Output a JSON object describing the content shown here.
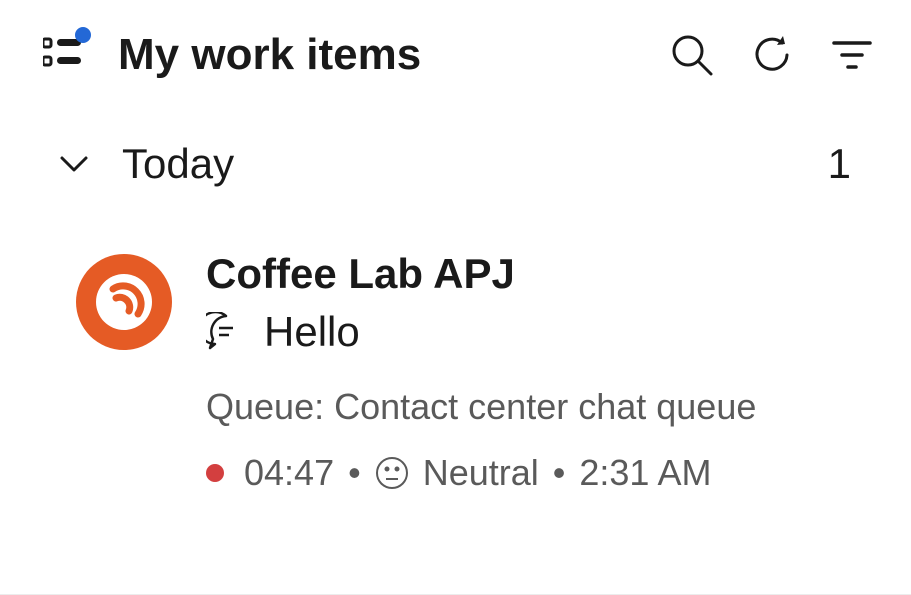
{
  "header": {
    "title": "My work items"
  },
  "section": {
    "label": "Today",
    "count": "1"
  },
  "item": {
    "title": "Coffee Lab APJ",
    "preview": "Hello",
    "queue_prefix": "Queue: ",
    "queue_name": "Contact center chat queue",
    "duration": "04:47",
    "sentiment": "Neutral",
    "time": "2:31 AM"
  },
  "icons": {
    "notification_color": "#2368d6",
    "avatar_bg": "#e55b25",
    "status_dot": "#d33f3f"
  }
}
